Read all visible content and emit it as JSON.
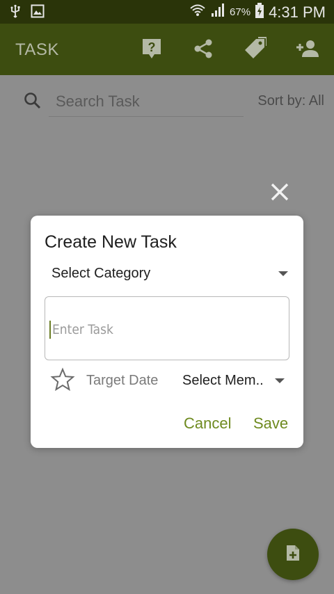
{
  "status_bar": {
    "battery_percent": "67%",
    "time": "4:31 PM",
    "icons": [
      "usb-icon",
      "image-icon",
      "wifi-icon",
      "signal-icon",
      "battery-icon"
    ]
  },
  "app_bar": {
    "title": "TASK",
    "actions": [
      "help-icon",
      "share-icon",
      "tag-icon",
      "add-person-icon"
    ]
  },
  "search": {
    "placeholder": "Search Task",
    "sort_label": "Sort by: All"
  },
  "dialog": {
    "title": "Create New Task",
    "category_label": "Select Category",
    "task_placeholder": "Enter Task",
    "target_date_label": "Target Date",
    "member_label": "Select Mem..",
    "cancel_label": "Cancel",
    "save_label": "Save"
  },
  "colors": {
    "app_bar": "#3d4d10",
    "status_bar": "#2a3409",
    "accent": "#6e8a1f",
    "overlay": "#8d8d8d"
  }
}
